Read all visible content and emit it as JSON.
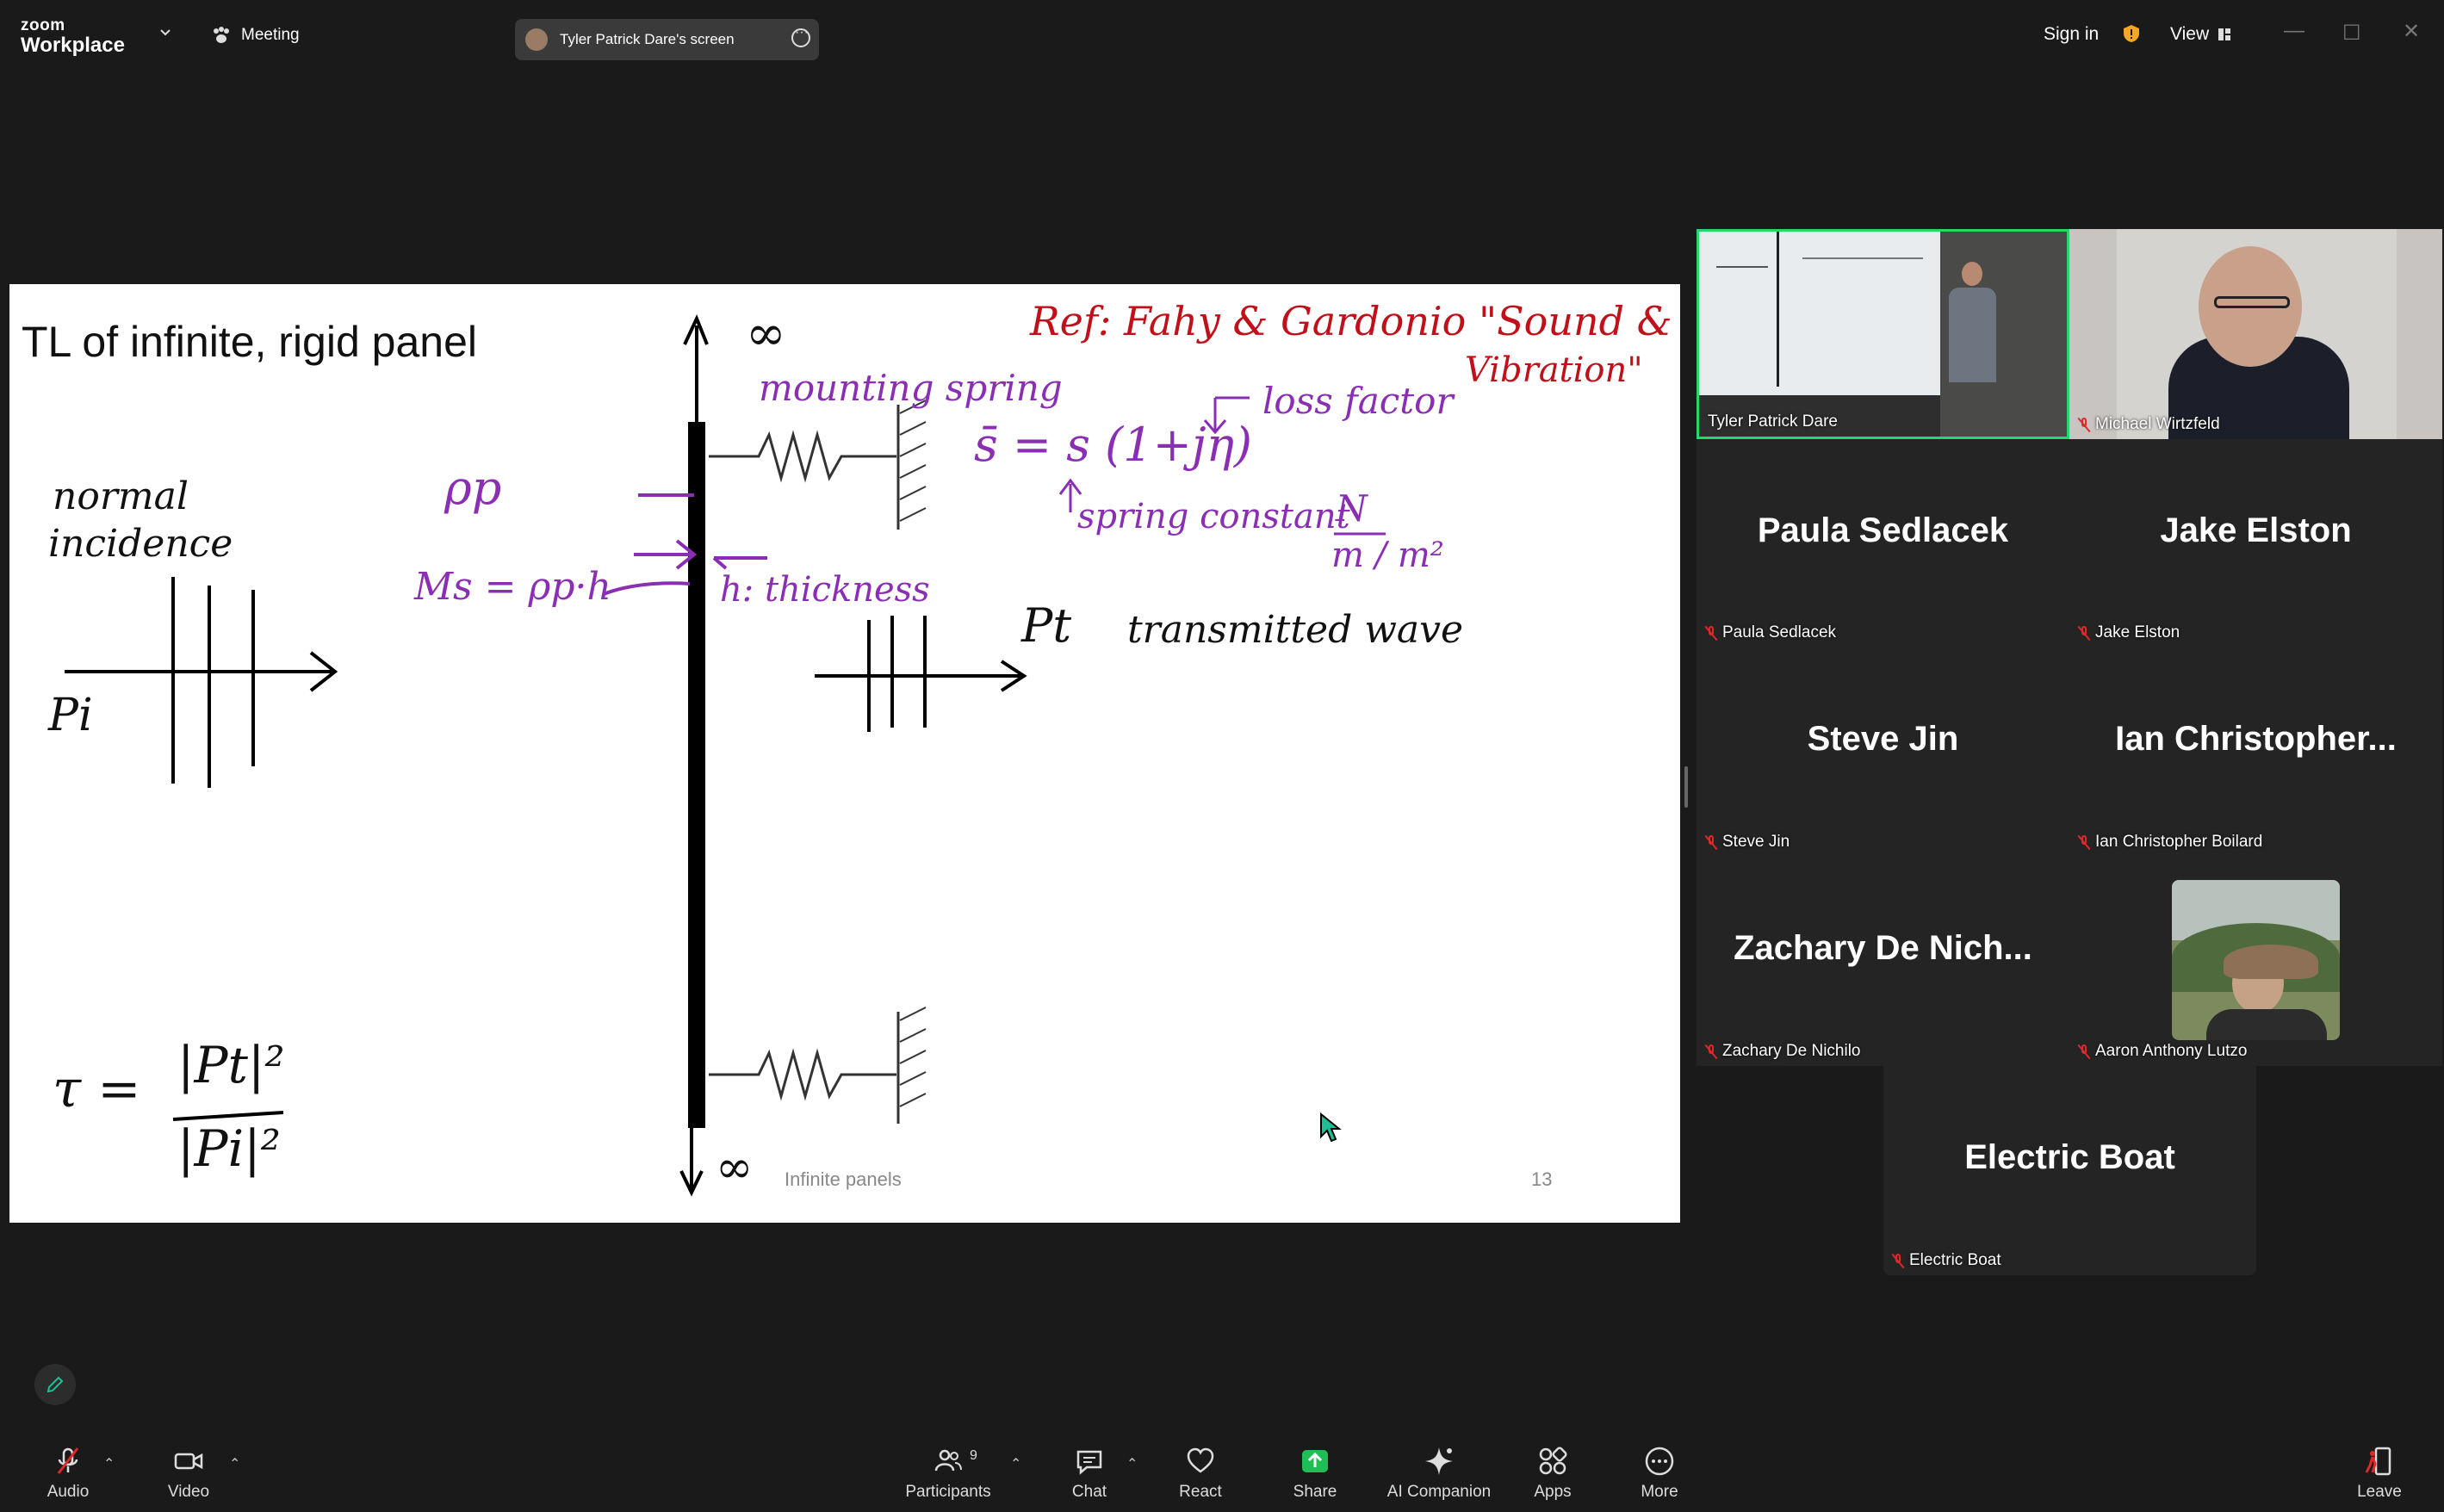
{
  "app": {
    "logo_top": "zoom",
    "logo_bottom": "Workplace",
    "meeting_label": "Meeting",
    "share_pill_text": "Tyler Patrick Dare's screen",
    "sign_in": "Sign in",
    "view": "View"
  },
  "slide": {
    "title": "TL of infinite, rigid panel",
    "footer": "Infinite panels",
    "page_number": "13",
    "ink": {
      "infinity_top": "∞",
      "infinity_bottom": "∞",
      "ref": "Ref: Fahy & Gardonio \"Sound & Structural",
      "ref2": "Vibration\"",
      "mounting_spring": "mounting spring",
      "loss_factor": "loss factor",
      "s_bar": "s̄ = s (1+jη)",
      "spring_constant": "spring constant",
      "units_num": "N",
      "units_den": "m / m²",
      "normal": "normal",
      "incidence": "incidence",
      "rho_p": "ρp",
      "ms_eq": "Ms = ρp·h",
      "h_thickness": "h: thickness",
      "pi": "Pi",
      "pt": "Pt",
      "transmitted_wave": "transmitted wave",
      "tau": "τ =",
      "tau_num": "|Pt|²",
      "tau_den": "|Pi|²"
    }
  },
  "participants": [
    {
      "name": "Tyler Patrick Dare",
      "display": "",
      "video": true
    },
    {
      "name": "Michael Wirtzfeld",
      "display": "",
      "video": true
    },
    {
      "name": "Paula Sedlacek",
      "display": "Paula Sedlacek",
      "video": false
    },
    {
      "name": "Jake Elston",
      "display": "Jake Elston",
      "video": false
    },
    {
      "name": "Steve Jin",
      "display": "Steve Jin",
      "video": false
    },
    {
      "name": "Ian Christopher Boilard",
      "display": "Ian  Christopher...",
      "video": false
    },
    {
      "name": "Zachary De Nichilo",
      "display": "Zachary  De  Nich...",
      "video": false
    },
    {
      "name": "Aaron Anthony Lutzo",
      "display": "",
      "video": true
    },
    {
      "name": "Electric Boat",
      "display": "Electric Boat",
      "video": false
    }
  ],
  "toolbar": {
    "audio": "Audio",
    "video": "Video",
    "participants": "Participants",
    "participants_count": "9",
    "chat": "Chat",
    "react": "React",
    "share": "Share",
    "ai_companion": "AI Companion",
    "apps": "Apps",
    "more": "More",
    "leave": "Leave"
  },
  "colors": {
    "share_green": "#1fbf55",
    "mic_off_red": "#e02828",
    "active_speaker": "#23d96b",
    "ink_purple": "#8a2fb3",
    "ink_red": "#c0101a"
  }
}
